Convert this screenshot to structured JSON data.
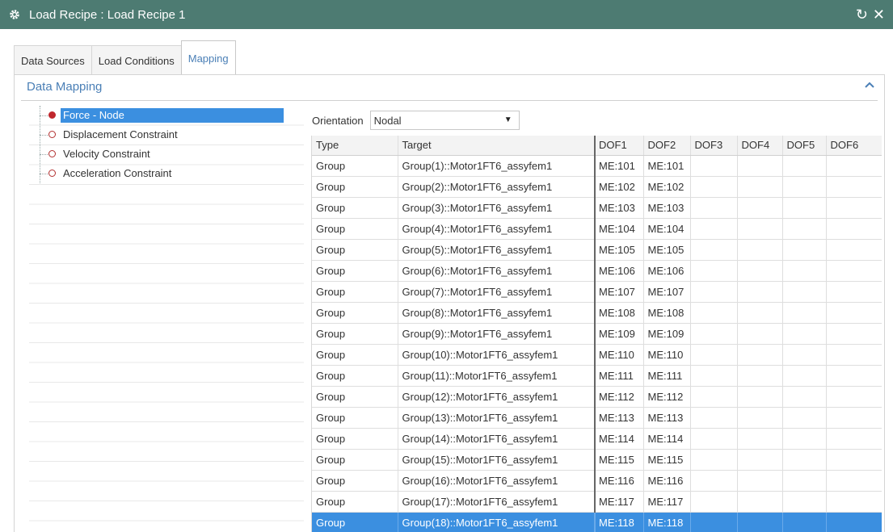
{
  "window": {
    "title": "Load Recipe : Load Recipe 1",
    "icons": {
      "app": "gear-icon",
      "reset": "reset-icon",
      "close": "close-icon"
    }
  },
  "tabs": [
    {
      "label": "Data Sources",
      "active": false
    },
    {
      "label": "Load Conditions",
      "active": false
    },
    {
      "label": "Mapping",
      "active": true
    }
  ],
  "section": {
    "title": "Data Mapping",
    "collapse_icon": "chevron-up-icon"
  },
  "tree": {
    "items": [
      {
        "label": "Force - Node",
        "selected": true
      },
      {
        "label": "Displacement Constraint",
        "selected": false
      },
      {
        "label": "Velocity Constraint",
        "selected": false
      },
      {
        "label": "Acceleration Constraint",
        "selected": false
      }
    ]
  },
  "orientation": {
    "label": "Orientation",
    "value": "Nodal"
  },
  "grid": {
    "columns": [
      "Type",
      "Target",
      "DOF1",
      "DOF2",
      "DOF3",
      "DOF4",
      "DOF5",
      "DOF6"
    ],
    "rows": [
      [
        "Group",
        "Group(1)::Motor1FT6_assyfem1",
        "ME:101",
        "ME:101",
        "",
        "",
        "",
        ""
      ],
      [
        "Group",
        "Group(2)::Motor1FT6_assyfem1",
        "ME:102",
        "ME:102",
        "",
        "",
        "",
        ""
      ],
      [
        "Group",
        "Group(3)::Motor1FT6_assyfem1",
        "ME:103",
        "ME:103",
        "",
        "",
        "",
        ""
      ],
      [
        "Group",
        "Group(4)::Motor1FT6_assyfem1",
        "ME:104",
        "ME:104",
        "",
        "",
        "",
        ""
      ],
      [
        "Group",
        "Group(5)::Motor1FT6_assyfem1",
        "ME:105",
        "ME:105",
        "",
        "",
        "",
        ""
      ],
      [
        "Group",
        "Group(6)::Motor1FT6_assyfem1",
        "ME:106",
        "ME:106",
        "",
        "",
        "",
        ""
      ],
      [
        "Group",
        "Group(7)::Motor1FT6_assyfem1",
        "ME:107",
        "ME:107",
        "",
        "",
        "",
        ""
      ],
      [
        "Group",
        "Group(8)::Motor1FT6_assyfem1",
        "ME:108",
        "ME:108",
        "",
        "",
        "",
        ""
      ],
      [
        "Group",
        "Group(9)::Motor1FT6_assyfem1",
        "ME:109",
        "ME:109",
        "",
        "",
        "",
        ""
      ],
      [
        "Group",
        "Group(10)::Motor1FT6_assyfem1",
        "ME:110",
        "ME:110",
        "",
        "",
        "",
        ""
      ],
      [
        "Group",
        "Group(11)::Motor1FT6_assyfem1",
        "ME:111",
        "ME:111",
        "",
        "",
        "",
        ""
      ],
      [
        "Group",
        "Group(12)::Motor1FT6_assyfem1",
        "ME:112",
        "ME:112",
        "",
        "",
        "",
        ""
      ],
      [
        "Group",
        "Group(13)::Motor1FT6_assyfem1",
        "ME:113",
        "ME:113",
        "",
        "",
        "",
        ""
      ],
      [
        "Group",
        "Group(14)::Motor1FT6_assyfem1",
        "ME:114",
        "ME:114",
        "",
        "",
        "",
        ""
      ],
      [
        "Group",
        "Group(15)::Motor1FT6_assyfem1",
        "ME:115",
        "ME:115",
        "",
        "",
        "",
        ""
      ],
      [
        "Group",
        "Group(16)::Motor1FT6_assyfem1",
        "ME:116",
        "ME:116",
        "",
        "",
        "",
        ""
      ],
      [
        "Group",
        "Group(17)::Motor1FT6_assyfem1",
        "ME:117",
        "ME:117",
        "",
        "",
        "",
        ""
      ],
      [
        "Group",
        "Group(18)::Motor1FT6_assyfem1",
        "ME:118",
        "ME:118",
        "",
        "",
        "",
        ""
      ]
    ],
    "selected_row": 17
  },
  "colors": {
    "titlebar": "#4d7b72",
    "accent": "#4a7fb6",
    "selection": "#3b8fe0",
    "node_marker": "#c0272d"
  }
}
